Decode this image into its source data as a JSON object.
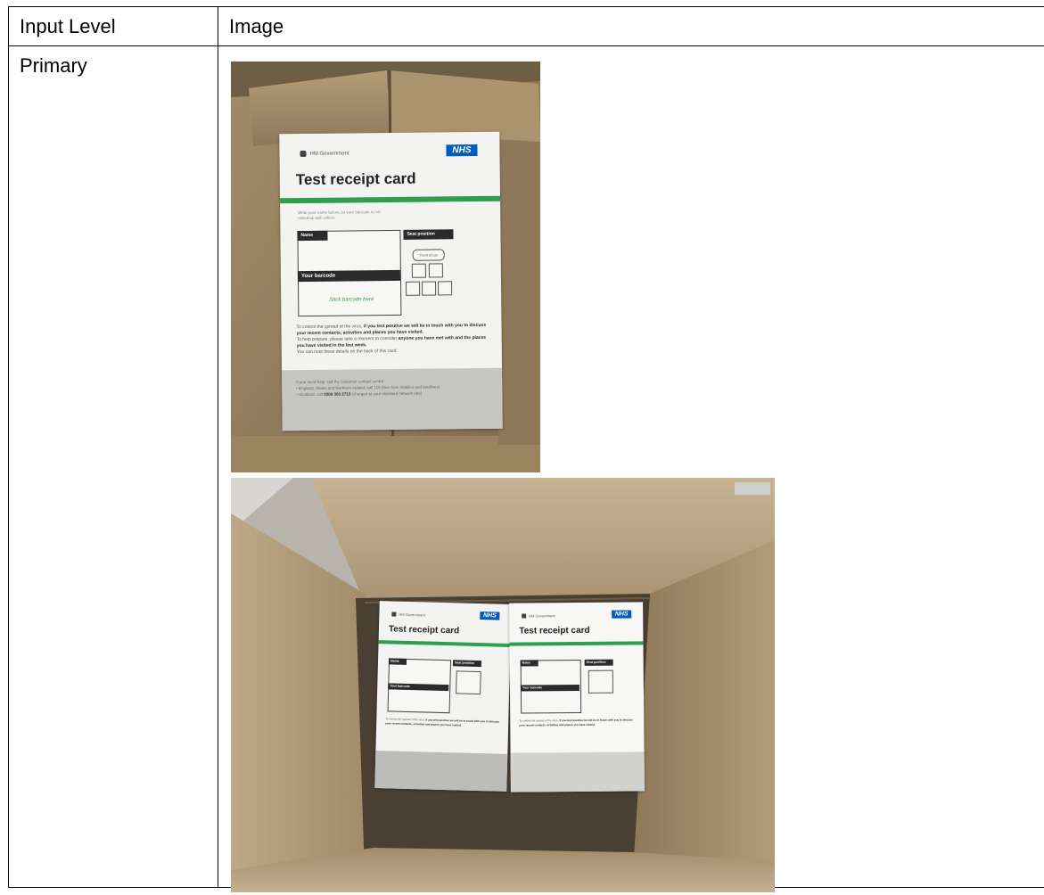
{
  "table": {
    "header": {
      "col1": "Input Level",
      "col2": "Image"
    },
    "rows": [
      {
        "level": "Primary"
      }
    ]
  },
  "card": {
    "gov_label": "HM Government",
    "nhs_logo": "NHS",
    "title": "Test receipt card",
    "instruction": "Write your name below, so your barcode is not mixed up with others.",
    "name_label": "Name",
    "seat_label": "Seat position",
    "front_of_car": "Front of car",
    "barcode_label": "Your barcode",
    "stick_barcode": "Stick barcode here",
    "body_1a": "To control the spread of the virus,",
    "body_1b": "if you test positive we will be in touch with you to discuss your recent contacts, activities and places you have visited.",
    "body_2a": "To help prepare, please take a moment to consider",
    "body_2b": "anyone you have met with and the places you have visited in the last week.",
    "body_3": "You can note these details on the back of this card.",
    "help_intro": "If you need help, call the customer contact centre:",
    "help_england": "England, Wales and Northern Ireland: call 119 (free from mobiles and landlines)",
    "help_scotland_a": "Scotland: call",
    "help_scotland_num": "0300 303 2713",
    "help_scotland_b": "(charged at your standard network rate)"
  },
  "colors": {
    "nhs_blue": "#005eb8",
    "card_green": "#2f9e4f",
    "cardboard": "#a8916f"
  }
}
